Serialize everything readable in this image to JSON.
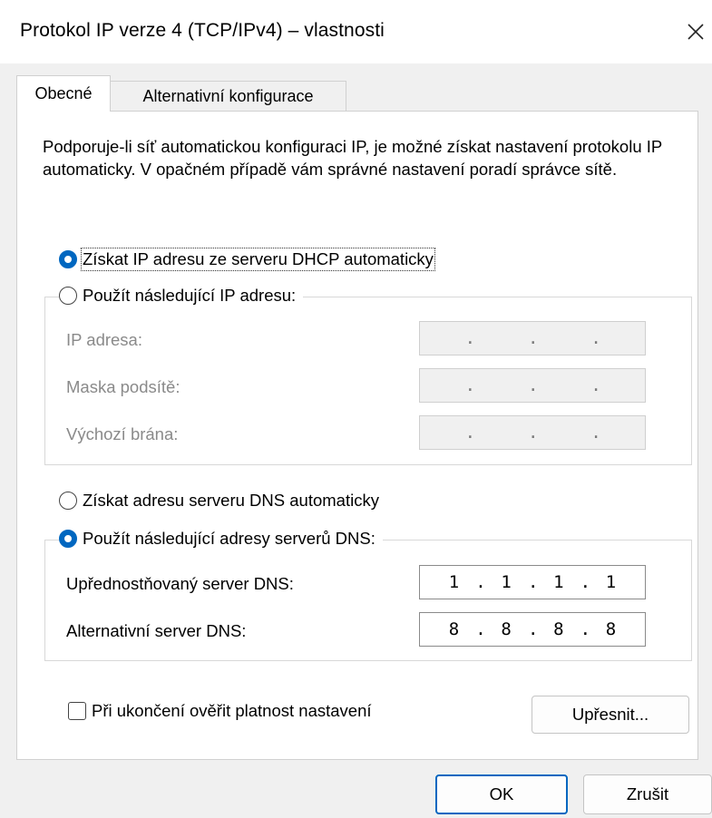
{
  "window": {
    "title": "Protokol IP verze 4 (TCP/IPv4) – vlastnosti",
    "close_glyph": "✕"
  },
  "tabs": [
    {
      "label": "Obecné",
      "active": true
    },
    {
      "label": "Alternativní konfigurace",
      "active": false
    }
  ],
  "intro_text": "Podporuje-li síť automatickou konfiguraci IP, je možné získat nastavení protokolu IP automaticky. V opačném případě vám správné nastavení poradí správce sítě.",
  "ip_section": {
    "auto_option": {
      "label": "Získat IP adresu ze serveru DHCP automaticky",
      "selected": true
    },
    "manual_option": {
      "label": "Použít následující IP adresu:",
      "selected": false
    },
    "fields": [
      {
        "label": "IP adresa:",
        "value": [
          ".",
          ".",
          "."
        ]
      },
      {
        "label": "Maska podsítě:",
        "value": [
          ".",
          ".",
          "."
        ]
      },
      {
        "label": "Výchozí brána:",
        "value": [
          ".",
          ".",
          "."
        ]
      }
    ]
  },
  "dns_section": {
    "auto_option": {
      "label": "Získat adresu serveru DNS automaticky",
      "selected": false
    },
    "manual_option": {
      "label": "Použít následující adresy serverů DNS:",
      "selected": true
    },
    "preferred": {
      "label": "Upřednostňovaný server DNS:",
      "octets": [
        "1",
        "1",
        "1",
        "1"
      ]
    },
    "alternate": {
      "label": "Alternativní server DNS:",
      "octets": [
        "8",
        "8",
        "8",
        "8"
      ]
    }
  },
  "validate_checkbox": {
    "label": "Při ukončení ověřit platnost nastavení",
    "checked": false
  },
  "buttons": {
    "advanced": "Upřesnit...",
    "ok": "OK",
    "cancel": "Zrušit"
  },
  "colors": {
    "accent": "#0067c0",
    "dialog_bg": "#f0f0f0",
    "panel_bg": "#ffffff"
  }
}
